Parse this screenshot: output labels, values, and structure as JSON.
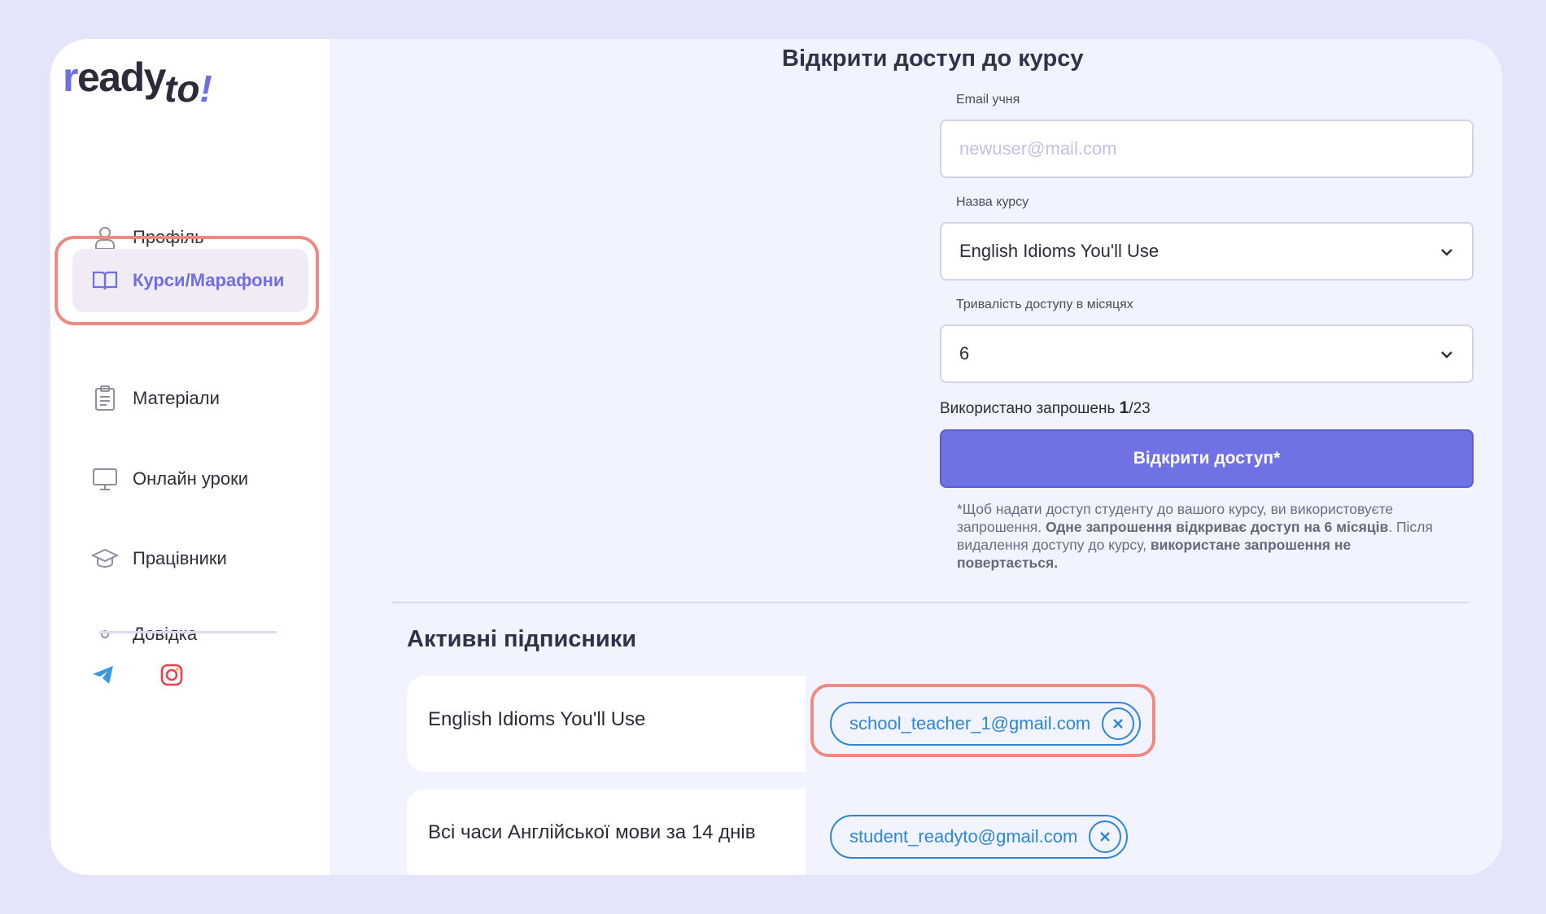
{
  "brand": {
    "logo_main": "ready",
    "logo_accent": "to!"
  },
  "sidebar": {
    "items": [
      {
        "label": "Профіль",
        "icon": "user-icon"
      },
      {
        "label": "Курси/Марафони",
        "icon": "book-icon",
        "active": true
      },
      {
        "label": "Матеріали",
        "icon": "clipboard-icon"
      },
      {
        "label": "Онлайн уроки",
        "icon": "monitor-icon"
      },
      {
        "label": "Працівники",
        "icon": "graduation-cap-icon"
      },
      {
        "label": "Довідка",
        "icon": "dot-icon"
      }
    ],
    "social": [
      "telegram-icon",
      "instagram-icon"
    ]
  },
  "form": {
    "title": "Відкрити доступ до курсу",
    "email_label": "Email учня",
    "email_placeholder": "newuser@mail.com",
    "course_label": "Назва курсу",
    "course_value": "English Idioms You'll Use",
    "duration_label": "Тривалість доступу в місяцях",
    "duration_value": "6",
    "invites_prefix": "Використано запрошень",
    "invites_used": "1",
    "invites_total": "/23",
    "submit_label": "Відкрити доступ*",
    "note_1": "*Щоб надати доступ студенту до вашого курсу, ви використовуєте запрошення.",
    "note_2": "Одне запрошення відкриває доступ на 6 місяців",
    "note_3": ". Після видалення доступу до курсу,",
    "note_4": "використане запрошення не повертається."
  },
  "subscribers": {
    "title": "Активні підписники",
    "rows": [
      {
        "course": "English Idioms You'll Use",
        "email": "school_teacher_1@gmail.com"
      },
      {
        "course": "Всі часи Англійської мови за 14 днів",
        "email": "student_readyto@gmail.com"
      }
    ]
  },
  "colors": {
    "accent": "#7071e2",
    "highlight": "#ee8a82",
    "chip": "#2f86d6",
    "background": "#e4e5fb"
  }
}
